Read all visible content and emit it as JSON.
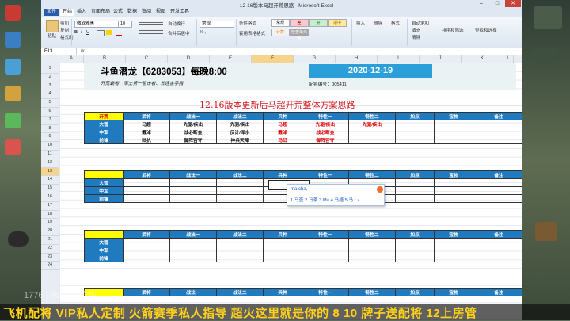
{
  "window": {
    "title": "12-16版本马超开荒思路 - Microsoft Excel",
    "minimize": "–",
    "maximize": "□",
    "close": "✕"
  },
  "menu_tabs": [
    "文件",
    "开始",
    "插入",
    "页面布局",
    "公式",
    "数据",
    "审阅",
    "视图",
    "开发工具"
  ],
  "ribbon": {
    "paste_label": "粘贴",
    "cut_label": "剪切",
    "copy_label": "复制",
    "format_painter_label": "格式刷",
    "font_name": "微软雅黑",
    "font_size": "10",
    "wrap_label": "自动换行",
    "merge_label": "合并后居中",
    "number_format": "常规",
    "cond_format_label": "条件格式",
    "table_format_label": "套用表格格式",
    "style_normal": "常规",
    "style_bad": "差",
    "style_good": "好",
    "style_neutral": "适中",
    "style_calc": "计算",
    "style_check": "检查单元格",
    "insert_label": "插入",
    "delete_label": "删除",
    "format_label": "格式",
    "autosum_label": "自动求和",
    "fill_label": "填充",
    "clear_label": "清除",
    "sort_label": "排序和筛选",
    "find_label": "查找和选择"
  },
  "formula_bar": {
    "name_box": "F13",
    "fx": "fx"
  },
  "columns": [
    "A",
    "B",
    "C",
    "D",
    "E",
    "F",
    "G",
    "H",
    "I",
    "J",
    "K",
    "L"
  ],
  "selected_column": "F",
  "selected_row": "13",
  "rows": [
    "1",
    "2",
    "3",
    "4",
    "5",
    "6",
    "7",
    "8",
    "9",
    "10",
    "11",
    "12",
    "13",
    "14",
    "15",
    "16",
    "17",
    "18",
    "19",
    "20",
    "21",
    "22",
    "23",
    "24"
  ],
  "header": {
    "main_title": "斗鱼潜龙【6283053】每晚8:00",
    "sub_title": "开荒霸者、率土第一狙击者、五连金手指",
    "date": "2020-12-19",
    "code": "配将编号：005411",
    "plan_title": "12.16版本更新后马超开荒整体方案思路"
  },
  "table_headers": [
    "开荒",
    "武将",
    "战法一",
    "战法二",
    "兵种",
    "特性一",
    "特性二",
    "加点",
    "宝物",
    "备注"
  ],
  "table1": [
    {
      "role": "大营",
      "hero": "马超",
      "s1": "先驱/疾击",
      "s2": "先驱/疾击",
      "troop": "马超",
      "t1": "先驱/疾击",
      "t2": "先驱/疾击"
    },
    {
      "role": "中军",
      "hero": "戴淖",
      "s1": "战必断金",
      "s2": "反计/浑水",
      "troop": "戴淖",
      "t1": "战必断金",
      "t2": ""
    },
    {
      "role": "前锋",
      "hero": "陆抗",
      "s1": "御阵否守",
      "s2": "神兵天降",
      "troop": "马岱",
      "t1": "御阵否守",
      "t2": ""
    }
  ],
  "role_labels": [
    "大营",
    "中军",
    "前锋"
  ],
  "ime": {
    "pinyin": "ma cha,",
    "candidates": "1.马查  2.马茶  3.Ma  4.马楂  5.马  ‹ ›"
  },
  "stream": {
    "ticker": "飞机配将  VIP私人定制  火箭赛季私人指导  超火这里就是你的  8  10  牌子送配将  12上房管",
    "watermark": "1776  |  水印  刘德华"
  }
}
